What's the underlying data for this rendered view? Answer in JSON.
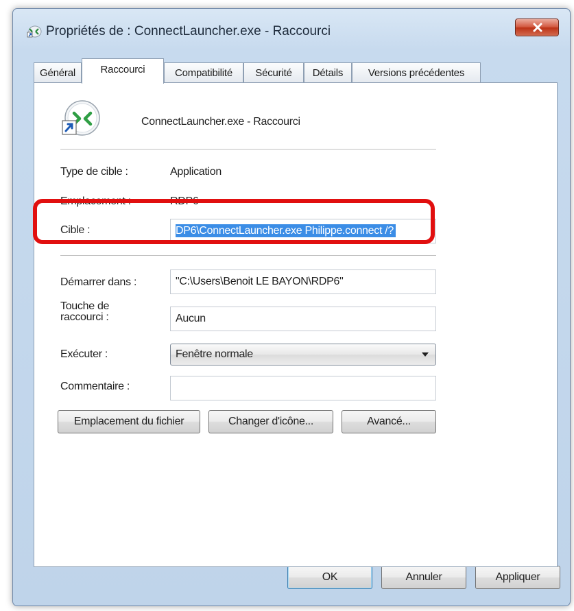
{
  "window": {
    "title": "Propriétés de : ConnectLauncher.exe - Raccourci",
    "close_icon": "close-icon",
    "app_icon": "shortcut-app-icon"
  },
  "tabs": [
    {
      "label": "Général",
      "active": false
    },
    {
      "label": "Raccourci",
      "active": true
    },
    {
      "label": "Compatibilité",
      "active": false
    },
    {
      "label": "Sécurité",
      "active": false
    },
    {
      "label": "Détails",
      "active": false
    },
    {
      "label": "Versions précédentes",
      "active": false
    }
  ],
  "shortcut": {
    "name": "ConnectLauncher.exe - Raccourci",
    "icon": "connect-launcher-shortcut-icon"
  },
  "info": {
    "target_type_label": "Type de cible :",
    "target_type_value": "Application",
    "location_label": "Emplacement :",
    "location_value": "RDP6"
  },
  "form": {
    "target_label": "Cible :",
    "target_value": "DP6\\ConnectLauncher.exe Philippe.connect /?",
    "start_in_label": "Démarrer dans :",
    "start_in_value": "\"C:\\Users\\Benoit LE BAYON\\RDP6\"",
    "hotkey_label": "Touche de raccourci :",
    "hotkey_value": "Aucun",
    "run_label": "Exécuter :",
    "run_value": "Fenêtre normale",
    "comment_label": "Commentaire :",
    "comment_value": ""
  },
  "actions": {
    "file_location": "Emplacement du fichier",
    "change_icon": "Changer d'icône...",
    "advanced": "Avancé..."
  },
  "footer": {
    "ok": "OK",
    "cancel": "Annuler",
    "apply": "Appliquer"
  },
  "colors": {
    "highlight_border": "#e10f0f",
    "selection": "#3b8de6",
    "close_button": "#c8442a"
  }
}
